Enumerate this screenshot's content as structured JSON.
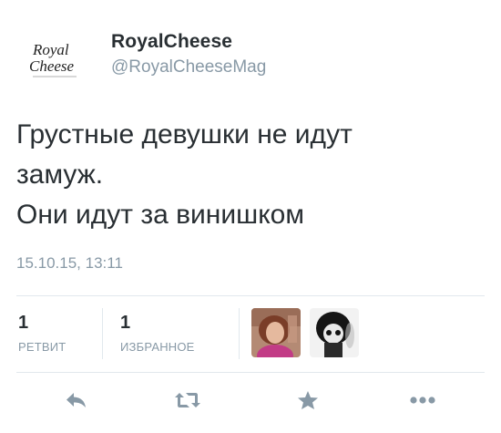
{
  "author": {
    "name": "RoyalCheese",
    "handle": "@RoyalCheeseMag",
    "avatar_text": [
      "Royal",
      "Cheese"
    ]
  },
  "tweet": {
    "lines": [
      "Грустные девушки не идут",
      "замуж.",
      "Они идут за винишком"
    ],
    "timestamp": "15.10.15, 13:11"
  },
  "stats": {
    "retweets": {
      "count": "1",
      "label": "РЕТВИТ"
    },
    "favorites": {
      "count": "1",
      "label": "ИЗБРАННОЕ"
    }
  },
  "actions": [
    "reply-icon",
    "retweet-icon",
    "favorite-star-icon",
    "more-options-icon"
  ],
  "colors": {
    "text": "#292f33",
    "muted": "#8899a6",
    "divider": "#e1e8ed"
  }
}
